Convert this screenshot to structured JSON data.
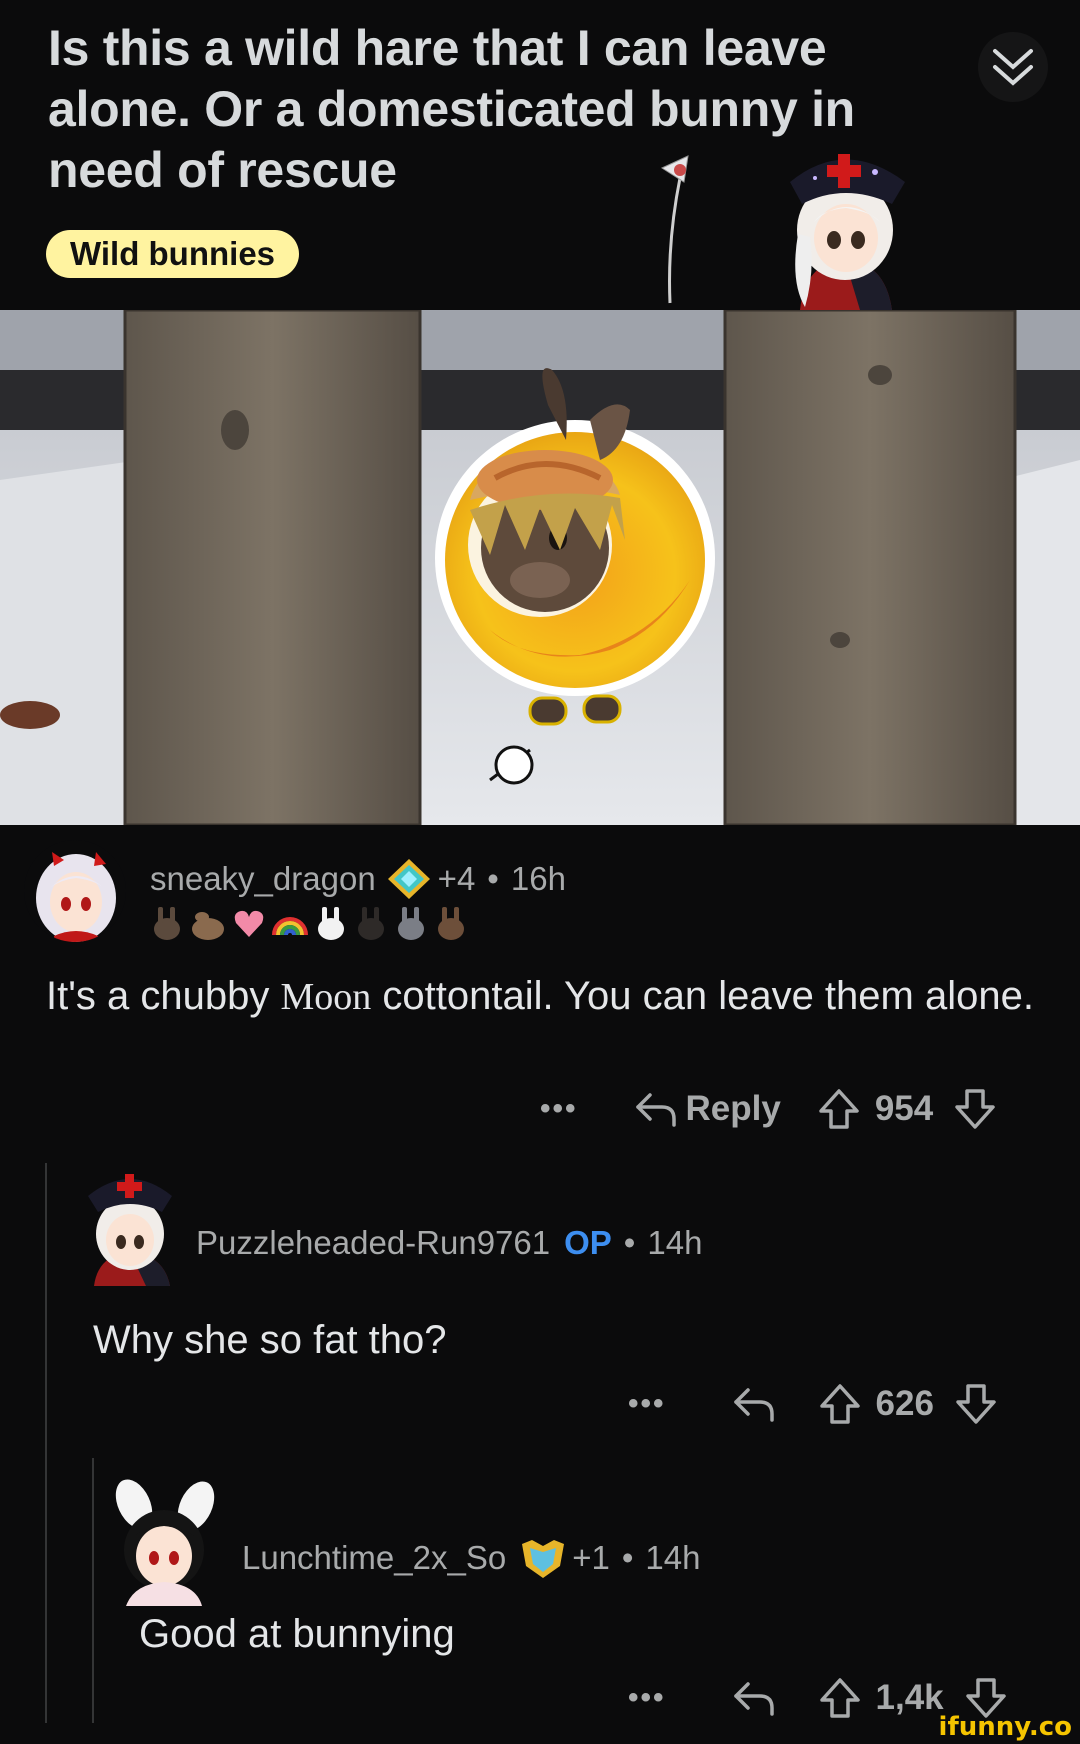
{
  "post": {
    "title": "Is this a wild hare that I can leave alone. Or a domesticated bunny in need of rescue",
    "flair": "Wild bunnies"
  },
  "comments": [
    {
      "author": "sneaky_dragon",
      "award_count": "+4",
      "age": "16h",
      "body_parts": [
        "It's a chubby",
        "Moon",
        "cottontail. You can leave them alone."
      ],
      "reply_label": "Reply",
      "votes": "954"
    },
    {
      "author": "Puzzleheaded-Run9761",
      "op_badge": "OP",
      "age": "14h",
      "body": "Why she so fat tho?",
      "votes": "626"
    },
    {
      "author": "Lunchtime_2x_So",
      "award_count": "+1",
      "age": "14h",
      "body": "Good at bunnying",
      "votes": "1,4k"
    }
  ],
  "ui": {
    "more": "•••",
    "separator": "•"
  },
  "watermark": "ifunny.co",
  "colors": {
    "background": "#0b0b0c",
    "flair_bg": "#fff3a0",
    "op": "#3d8ef0",
    "text": "#d7dadc",
    "meta": "#a8aaab"
  }
}
